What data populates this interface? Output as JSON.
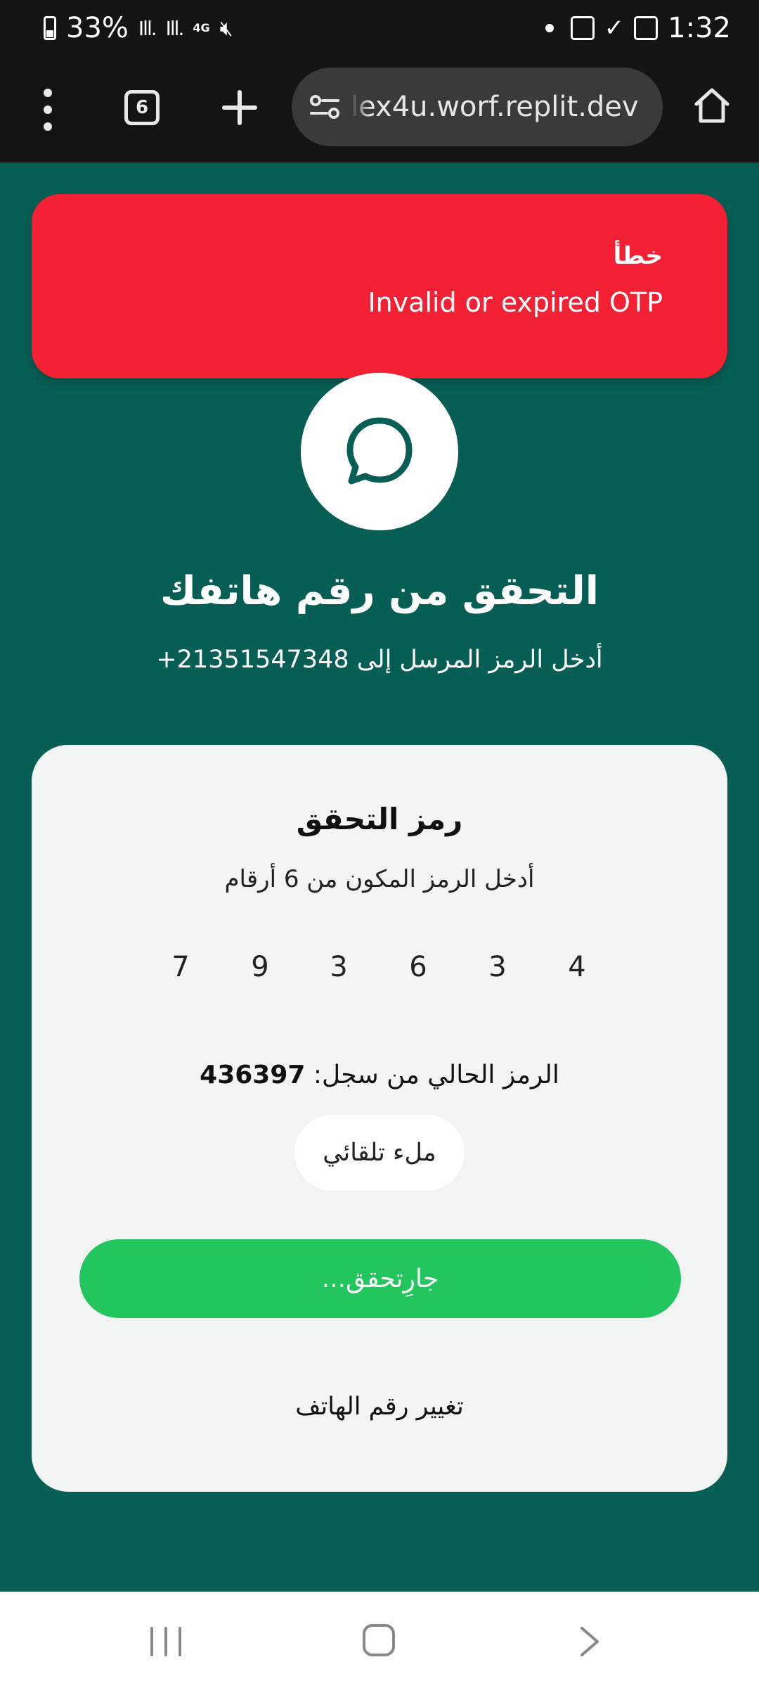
{
  "status_bar": {
    "battery": "33%",
    "network": "4G",
    "time": "1:32"
  },
  "browser": {
    "tab_count": "6",
    "url": "lex4u.worf.replit.dev"
  },
  "toast": {
    "title": "خطأ",
    "message": "Invalid or expired OTP",
    "color": "#f32133"
  },
  "header": {
    "title": "التحقق من رقم هاتفك",
    "subtitle": "أدخل الرمز المرسل إلى 21351547348+"
  },
  "card": {
    "title": "رمز التحقق",
    "description": "أدخل الرمز المكون من 6 أرقام",
    "otp_digits": [
      "4",
      "3",
      "6",
      "3",
      "9",
      "7"
    ],
    "current_code_label": "الرمز الحالي من سجل:",
    "current_code_value": "436397",
    "autofill_label": "ملء تلقائي",
    "verify_label": "جارِتحقق...",
    "change_phone_label": "تغيير رقم الهاتف"
  },
  "colors": {
    "background": "#075e54",
    "verify_button": "#22c55e"
  },
  "icons": {
    "logo": "chat-bubble-icon"
  }
}
